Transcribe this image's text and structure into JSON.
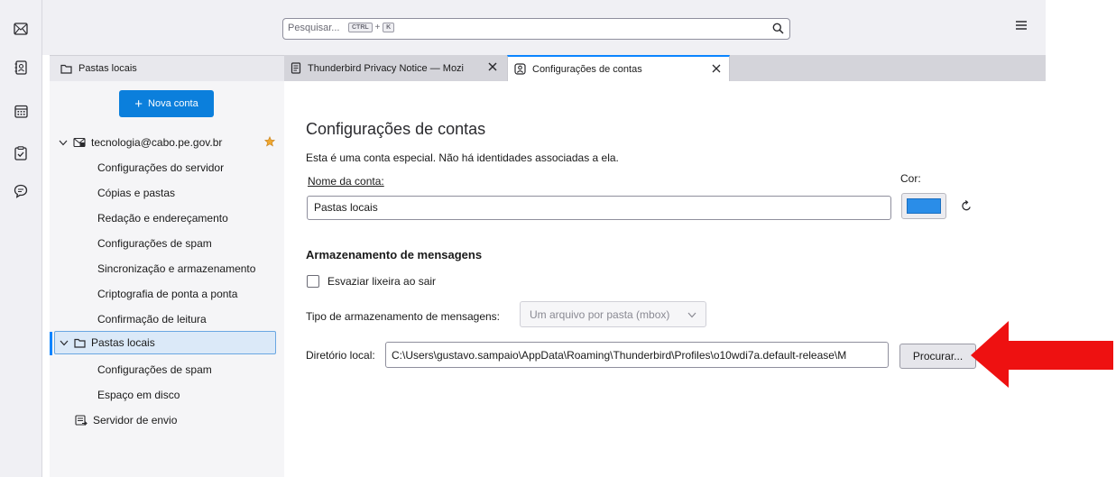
{
  "toolbar": {
    "search_placeholder": "Pesquisar...",
    "shortcut_key1": "CTRL",
    "shortcut_plus": "+",
    "shortcut_key2": "K"
  },
  "folder_pane": {
    "header": "Pastas locais"
  },
  "tabs": [
    {
      "label": "Thunderbird Privacy Notice — Mozi",
      "active": false
    },
    {
      "label": "Configurações de contas",
      "active": true
    }
  ],
  "sidebar": {
    "new_account": "Nova conta",
    "account_email": "tecnologia@cabo.pe.gov.br",
    "account_items": [
      "Configurações do servidor",
      "Cópias e pastas",
      "Redação e endereçamento",
      "Configurações de spam",
      "Sincronização e armazenamento",
      "Criptografia de ponta a ponta",
      "Confirmação de leitura"
    ],
    "local_folders": "Pastas locais",
    "local_items": [
      "Configurações de spam",
      "Espaço em disco"
    ],
    "outgoing_server": "Servidor de envio"
  },
  "main": {
    "title": "Configurações de contas",
    "special_note": "Esta é uma conta especial. Não há identidades associadas a ela.",
    "name_label": "Nome da conta:",
    "color_label": "Cor:",
    "account_name_value": "Pastas locais",
    "account_color": "#2a8de8",
    "storage_heading": "Armazenamento de mensagens",
    "empty_trash_label": "Esvaziar lixeira ao sair",
    "store_type_label": "Tipo de armazenamento de mensagens:",
    "store_type_value": "Um arquivo por pasta (mbox)",
    "local_dir_label": "Diretório local:",
    "local_dir_value": "C:\\Users\\gustavo.sampaio\\AppData\\Roaming\\Thunderbird\\Profiles\\o10wdi7a.default-release\\M",
    "browse_label": "Procurar..."
  },
  "colors": {
    "accent": "#0a84ff",
    "new_account_button": "#0b7fdc",
    "annotation_arrow": "#ee1111"
  }
}
